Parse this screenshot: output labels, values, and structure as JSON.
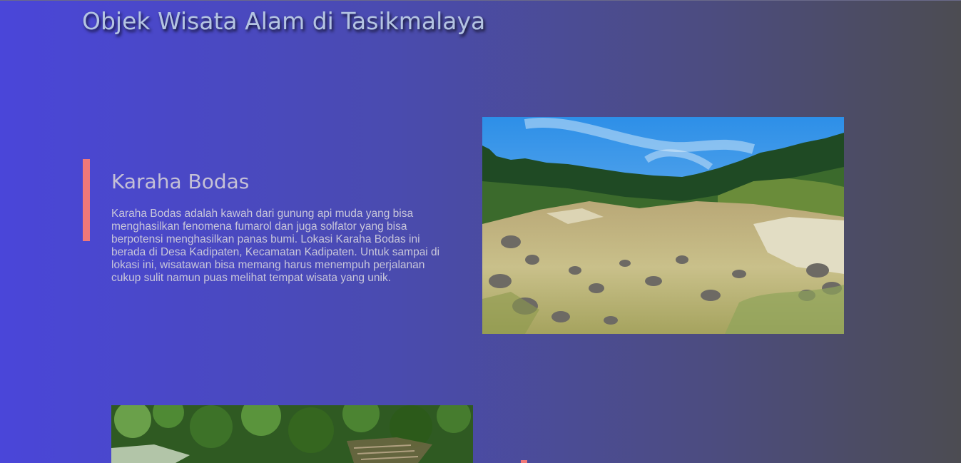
{
  "page": {
    "title": "Objek Wisata Alam di Tasikmalaya"
  },
  "destinations": [
    {
      "name": "Karaha Bodas",
      "description": "Karaha Bodas adalah kawah dari gunung api muda yang bisa menghasilkan fenomena fumarol dan juga solfator yang bisa berpotensi menghasilkan panas bumi. Lokasi Karaha Bodas ini berada di Desa Kadipaten, Kecamatan Kadipaten. Untuk sampai di lokasi ini, wisatawan bisa memang harus menempuh perjalanan cukup sulit namun puas melihat tempat wisata yang unik.",
      "image": "crater-landscape-photo"
    },
    {
      "image": "forest-river-photo"
    }
  ],
  "colors": {
    "accent": "#f07878",
    "title_text": "#b4c4e2",
    "body_text": "#c8c6da",
    "bg_left": "#4a46d9",
    "bg_right": "#4c4c52"
  }
}
